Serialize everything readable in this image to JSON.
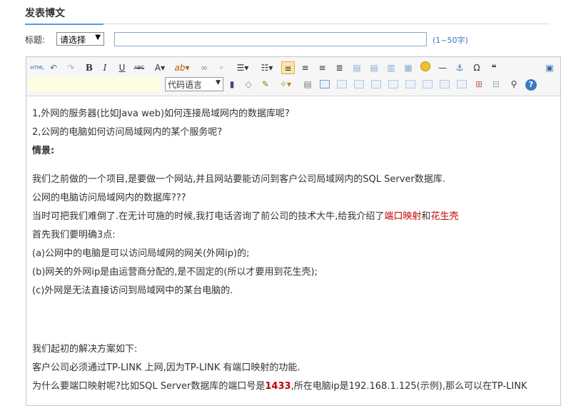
{
  "page": {
    "section_title": "发表博文"
  },
  "form": {
    "title_label": "标题:",
    "category_select": "请选择",
    "title_value": "",
    "title_hint": "(1~50字)"
  },
  "toolbar": {
    "html": "HTML",
    "bold": "B",
    "italic": "I",
    "underline": "U",
    "strike": "ABC",
    "font": "A",
    "code_lang": "代码语言",
    "omega": "Ω",
    "quote": "❝",
    "help": "?"
  },
  "content": {
    "lines": [
      "1,外网的服务器(比如Java web)如何连接局域网内的数据库呢?",
      "2,公网的电脑如何访问局域网内的某个服务呢?",
      "情景:",
      "我们之前做的一个项目,是要做一个网站,并且网站要能访问到客户公司局域网内的SQL Server数据库.",
      "公网的电脑访问局域网内的数据库???",
      "首先我们要明确3点:",
      "(a)公网中的电脑是可以访问局域网的网关(外网ip)的;",
      "(b)网关的外网ip是由运营商分配的,是不固定的(所以才要用到花生壳);",
      "(c)外网是无法直接访问到局域网中的某台电脑的.",
      "我们起初的解决方案如下:",
      "客户公司必须通过TP-LINK 上网,因为TP-LINK 有端口映射的功能."
    ],
    "line_call": {
      "before": "当时可把我们难倒了.在无计可施的时候,我打电话咨询了前公司的技术大牛,给我介绍了",
      "red1": "端口映射",
      "mid": "和",
      "red2": "花生壳"
    },
    "line_port": {
      "before": "为什么要端口映射呢?比如SQL Server数据库的端口号是",
      "port": "1433",
      "after": ",所在电脑ip是192.168.1.125(示例),那么可以在TP-LINK"
    }
  }
}
